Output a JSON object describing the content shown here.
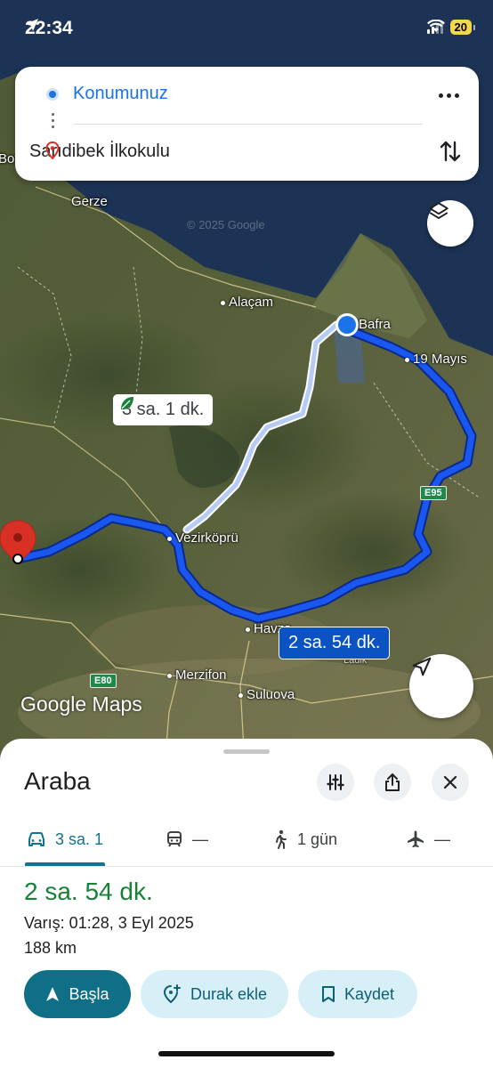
{
  "status_bar": {
    "time": "22:34",
    "battery": "20"
  },
  "route_card": {
    "origin": "Konumunuz",
    "destination": "Sarıdibek İlkokulu",
    "more_icon": "more-horizontal-icon",
    "swap_icon": "swap-vertical-icon"
  },
  "map": {
    "watermark": "© 2025 Google",
    "places": [
      "Gerze",
      "Alaçam",
      "Bafra",
      "19 Mayıs",
      "Vezirköprü",
      "Havza",
      "Merzifon",
      "Suluova",
      "Ladik",
      "Boyabat"
    ],
    "road_badges": [
      "E95",
      "E80"
    ],
    "alt_route_label": "3 sa. 1 dk.",
    "main_route_label": "2 sa. 54 dk.",
    "logo": "Google Maps",
    "colors": {
      "main_route": "#1a56f0",
      "alt_route": "#b7ccf5",
      "origin": "#1a73e8",
      "destination_pin": "#d93025"
    }
  },
  "sheet": {
    "title": "Araba",
    "tabs": [
      {
        "icon": "car-icon",
        "label": "3 sa. 1"
      },
      {
        "icon": "train-icon",
        "label": "—"
      },
      {
        "icon": "walk-icon",
        "label": "1 gün"
      },
      {
        "icon": "plane-icon",
        "label": "—"
      }
    ],
    "duration": "2 sa. 54 dk.",
    "arrival": "Varış: 01:28, 3 Eyl 2025",
    "distance": "188 km",
    "buttons": {
      "start": "Başla",
      "add_stop": "Durak ekle",
      "save": "Kaydet"
    },
    "colors": {
      "accent": "#0e7490",
      "duration": "#188038"
    }
  }
}
